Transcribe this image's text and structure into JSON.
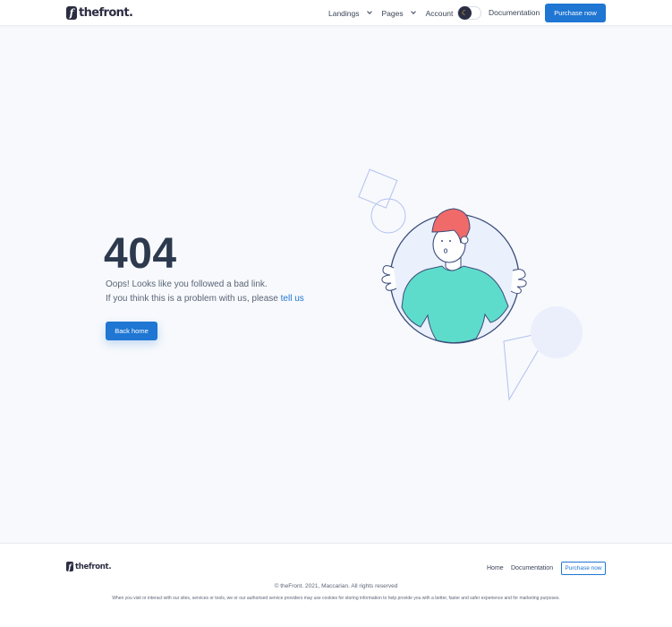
{
  "header": {
    "logo_letter": "f",
    "logo_text": "thefront.",
    "nav": [
      {
        "label": "Landings"
      },
      {
        "label": "Pages"
      },
      {
        "label": "Account"
      }
    ],
    "theme_toggle_icon": "moon-icon",
    "documentation_label": "Documentation",
    "purchase_label": "Purchase now"
  },
  "main": {
    "error_code": "404",
    "message_line1": "Oops! Looks like you followed a bad link.",
    "message_line2_prefix": "If you think this is a problem with us, please ",
    "message_line2_link": "tell us",
    "back_button_label": "Back home"
  },
  "colors": {
    "accent": "#1f76d3",
    "hair": "#f06a6a",
    "shirt": "#5ddccb",
    "outline": "#3b4c7a",
    "shape_stroke": "#b3c1f0"
  },
  "footer": {
    "logo_letter": "f",
    "logo_text": "thefront.",
    "home_label": "Home",
    "documentation_label": "Documentation",
    "purchase_label": "Purchase now",
    "copyright": "© theFront. 2021, Maccarian. All rights reserved",
    "cookie_note": "When you visit or interact with our sites, services or tools, we or our authorised service providers may use cookies for storing information to help provide you with a better, faster and safer experience and for marketing purposes."
  }
}
